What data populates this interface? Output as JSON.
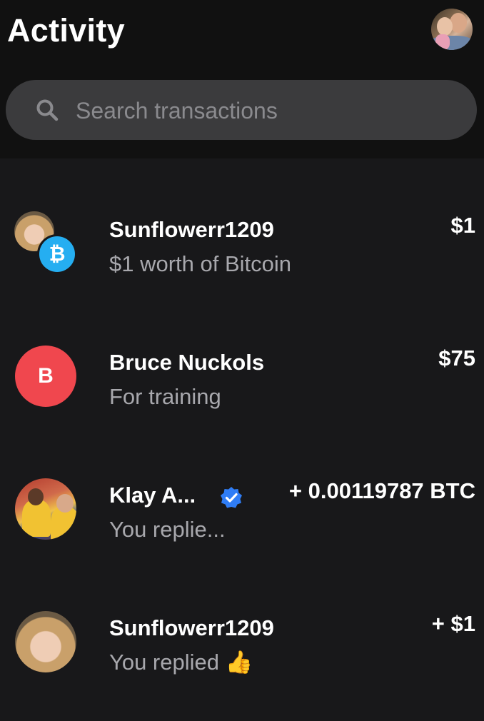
{
  "header": {
    "title": "Activity"
  },
  "search": {
    "placeholder": "Search transactions",
    "icon": "search-icon"
  },
  "transactions": [
    {
      "name": "Sunflowerr1209",
      "description": "$1 worth of Bitcoin",
      "amount": "$1",
      "avatar": "photo-avatar",
      "badge": "bitcoin-badge-icon",
      "badge_symbol": "₿",
      "badge_color": "#25aef1"
    },
    {
      "name": "Bruce Nuckols",
      "description": "For training",
      "amount": "$75",
      "avatar_letter": "B",
      "avatar_color": "#f0474e"
    },
    {
      "name": "Klay A...",
      "description": "You replie...",
      "amount": "+ 0.00119787 BTC",
      "avatar": "photo-avatar",
      "verified_icon": "verified-icon",
      "verified_color": "#2f7df6"
    },
    {
      "name": "Sunflowerr1209",
      "description": "You replied 👍",
      "amount": "+ $1",
      "avatar": "photo-avatar"
    }
  ],
  "colors": {
    "background": "#18181a",
    "header_background": "#111111",
    "search_background": "#3b3b3d",
    "secondary_text": "#a8a8ad"
  }
}
